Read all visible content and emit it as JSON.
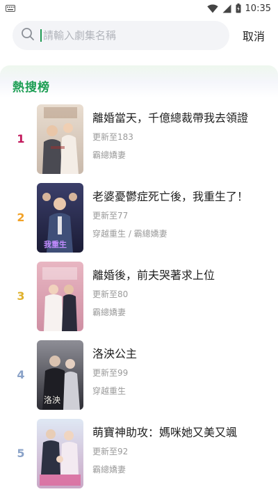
{
  "status_bar": {
    "time": "10:35",
    "icons": [
      "keyboard-icon",
      "wifi-icon",
      "cellular-icon",
      "battery-icon"
    ]
  },
  "search": {
    "placeholder": "請輸入劇集名稱",
    "value": "",
    "cancel_label": "取消"
  },
  "hot_list": {
    "title": "熱搜榜",
    "items": [
      {
        "rank": "1",
        "rank_color": "#c2185b",
        "title": "離婚當天，千億總裁帶我去領證",
        "update": "更新至183",
        "tags": "霸總嬌妻"
      },
      {
        "rank": "2",
        "rank_color": "#f2a227",
        "title": "老婆憂鬱症死亡後，我重生了！",
        "update": "更新至77",
        "tags": "穿越重生 / 霸總嬌妻"
      },
      {
        "rank": "3",
        "rank_color": "#e0b12c",
        "title": "離婚後，前夫哭著求上位",
        "update": "更新至80",
        "tags": "霸總嬌妻"
      },
      {
        "rank": "4",
        "rank_color": "#8aa2c8",
        "title": "洛泱公主",
        "update": "更新至99",
        "tags": "穿越重生"
      },
      {
        "rank": "5",
        "rank_color": "#8aa2c8",
        "title": "萌寶神助攻：媽咪她又美又颯",
        "update": "更新至92",
        "tags": "霸總嬌妻"
      }
    ]
  },
  "colors": {
    "accent": "#1c9e53",
    "search_bg": "#f3f4f7",
    "meta_text": "#9a9a9a"
  }
}
